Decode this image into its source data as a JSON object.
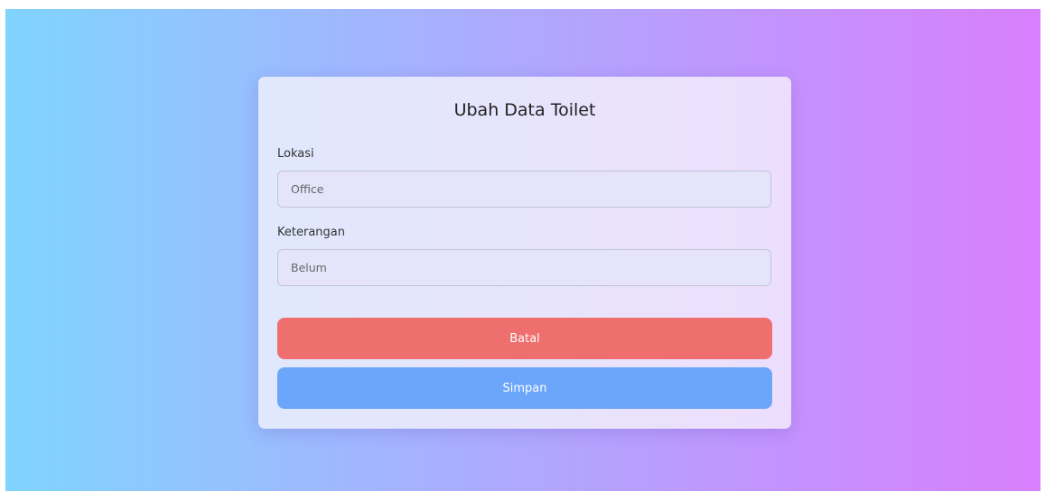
{
  "form": {
    "title": "Ubah Data Toilet",
    "lokasi_label": "Lokasi",
    "lokasi_value": "Office",
    "keterangan_label": "Keterangan",
    "keterangan_value": "Belum",
    "cancel_label": "Batal",
    "save_label": "Simpan"
  },
  "colors": {
    "cancel_button": "#ee6f6e",
    "save_button": "#6ba6fb",
    "gradient_start": "#80d4fd",
    "gradient_end": "#d87ffd"
  }
}
